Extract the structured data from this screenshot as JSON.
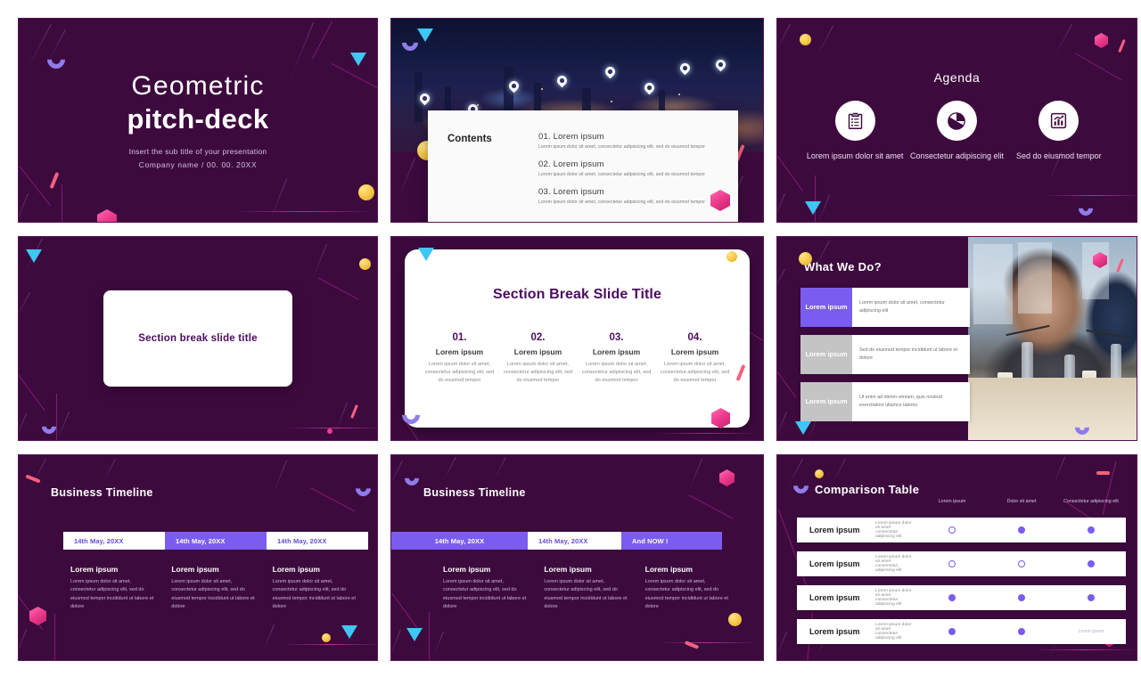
{
  "theme": {
    "background": "#3d0a3e",
    "accent_purple": "#7b5cf0",
    "accent_pink": "#ee3d8f",
    "accent_yellow": "#f7cb4e",
    "accent_cyan": "#3ec6f5",
    "card_white": "#ffffff",
    "title_ink": "#4a0c5e"
  },
  "slide1": {
    "title_line1": "Geometric",
    "title_line2": "pitch-deck",
    "subtitle": "Insert the sub title of your presentation",
    "meta": "Company name  /  00. 00. 20XX"
  },
  "slide2": {
    "heading": "Contents",
    "items": [
      {
        "title": "01. Lorem ipsum",
        "desc": "Lorem ipsum dolor sit amet, consectetur adipisicing elit, sed do eiusmod tempor"
      },
      {
        "title": "02. Lorem ipsum",
        "desc": "Lorem ipsum dolor sit amet, consectetur adipisicing elit, sed do eiusmod tempor"
      },
      {
        "title": "03. Lorem ipsum",
        "desc": "Lorem ipsum dolor sit amet, consectetur adipisicing elit, sed do eiusmod tempor"
      }
    ]
  },
  "slide3": {
    "title": "Agenda",
    "items": [
      {
        "icon": "clipboard-checklist-icon",
        "caption": "Lorem ipsum dolor sit amet"
      },
      {
        "icon": "pie-chart-icon",
        "caption": "Consectetur adipiscing elit"
      },
      {
        "icon": "bar-chart-growth-icon",
        "caption": "Sed do eiusmod tempor"
      }
    ]
  },
  "slide4": {
    "title": "Section break slide title"
  },
  "slide5": {
    "title": "Section Break Slide Title",
    "columns": [
      {
        "num": "01.",
        "sub": "Lorem ipsum",
        "desc": "Lorem ipsum dolor sit amet, consectetur adipisicing elit, sed do eiusmod tempor"
      },
      {
        "num": "02.",
        "sub": "Lorem ipsum",
        "desc": "Lorem ipsum dolor sit amet, consectetur adipisicing elit, sed do eiusmod tempor"
      },
      {
        "num": "03.",
        "sub": "Lorem ipsum",
        "desc": "Lorem ipsum dolor sit amet, consectetur adipisicing elit, sed do eiusmod tempor"
      },
      {
        "num": "04.",
        "sub": "Lorem ipsum",
        "desc": "Lorem ipsum dolor sit amet, consectetur adipisicing elit, sed do eiusmod tempor"
      }
    ]
  },
  "slide6": {
    "title": "What We Do?",
    "rows": [
      {
        "key": "Lorem ipsum",
        "value": "Lorem ipsum dolor sit amet, consectetur adipiscing elit",
        "key_color": "#7b5cf0"
      },
      {
        "key": "Lorem ipsum",
        "value": "Sed do eiusmod tempor incididunt ut labore et dolore",
        "key_color": "#c4c4c4"
      },
      {
        "key": "Lorem ipsum",
        "value": "Ut enim ad minim veniam, quis nostrud exercitation ullamco laboris",
        "key_color": "#c4c4c4"
      }
    ],
    "photo_alt": "business-meeting-photo"
  },
  "slide7": {
    "title": "Business Timeline",
    "bar": [
      {
        "label": "14th May, 20XX",
        "style": "white"
      },
      {
        "label": "14th May, 20XX",
        "style": "purple"
      },
      {
        "label": "14th May, 20XX",
        "style": "white"
      }
    ],
    "columns": [
      {
        "heading": "Lorem ipsum",
        "desc": "Lorem ipsum dolor sit amet, consectetur adipiscing elit, sed do eiusmod tempor incididunt ut labore et dolore"
      },
      {
        "heading": "Lorem ipsum",
        "desc": "Lorem ipsum dolor sit amet, consectetur adipiscing elit, sed do eiusmod tempor incididunt ut labore et dolore"
      },
      {
        "heading": "Lorem ipsum",
        "desc": "Lorem ipsum dolor sit amet, consectetur adipiscing elit, sed do eiusmod tempor incididunt ut labore et dolore"
      }
    ]
  },
  "slide8": {
    "title": "Business Timeline",
    "bar": [
      {
        "label": "14th May, 20XX",
        "style": "clear"
      },
      {
        "label": "14th May, 20XX",
        "style": "white"
      },
      {
        "label": "And NOW !",
        "style": "clear"
      }
    ],
    "columns": [
      {
        "heading": "Lorem ipsum",
        "desc": "Lorem ipsum dolor sit amet, consectetur adipiscing elit, sed do eiusmod tempor incididunt ut labore et dolore"
      },
      {
        "heading": "Lorem ipsum",
        "desc": "Lorem ipsum dolor sit amet, consectetur adipiscing elit, sed do eiusmod tempor incididunt ut labore et dolore"
      },
      {
        "heading": "Lorem ipsum",
        "desc": "Lorem ipsum dolor sit amet, consectetur adipiscing elit, sed do eiusmod tempor incididunt ut labore et dolore"
      }
    ]
  },
  "slide9": {
    "title": "Comparison Table",
    "headers": [
      "Lorem ipsum",
      "Dolor sit amet",
      "Consectetur adipiscing elit"
    ],
    "rows": [
      {
        "label": "Lorem ipsum",
        "desc": "Lorem ipsum dolor sit amet consectetur adipiscing elit",
        "cells": [
          "hollow",
          "filled",
          "filled"
        ]
      },
      {
        "label": "Lorem ipsum",
        "desc": "Lorem ipsum dolor sit amet consectetur adipiscing elit",
        "cells": [
          "hollow",
          "hollow",
          "filled"
        ]
      },
      {
        "label": "Lorem ipsum",
        "desc": "Lorem ipsum dolor sit amet consectetur adipiscing elit",
        "cells": [
          "filled",
          "filled",
          "filled"
        ]
      },
      {
        "label": "Lorem ipsum",
        "desc": "Lorem ipsum dolor sit amet consectetur adipiscing elit",
        "cells": [
          "filled",
          "filled",
          "Lorem ipsum"
        ]
      }
    ]
  }
}
